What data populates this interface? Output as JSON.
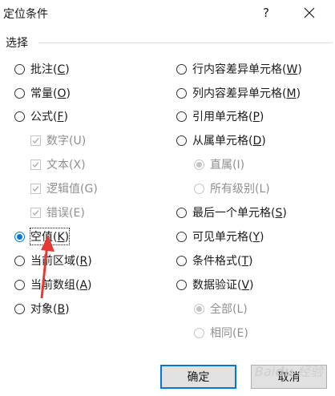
{
  "dialog": {
    "title": "定位条件",
    "help_label": "?",
    "section_label": "选择"
  },
  "left_options": [
    {
      "text": "批注",
      "key": "C",
      "type": "radio",
      "state": "normal"
    },
    {
      "text": "常量",
      "key": "O",
      "type": "radio",
      "state": "normal"
    },
    {
      "text": "公式",
      "key": "F",
      "type": "radio",
      "state": "normal"
    },
    {
      "text": "数字",
      "key": "U",
      "type": "checkbox",
      "state": "disabled-checked"
    },
    {
      "text": "文本",
      "key": "X",
      "type": "checkbox",
      "state": "disabled-checked"
    },
    {
      "text": "逻辑值",
      "key": "G",
      "type": "checkbox",
      "state": "disabled-checked"
    },
    {
      "text": "错误",
      "key": "E",
      "type": "checkbox",
      "state": "disabled-checked"
    },
    {
      "text": "空值",
      "key": "K",
      "type": "radio",
      "state": "selected"
    },
    {
      "text": "当前区域",
      "key": "R",
      "type": "radio",
      "state": "normal"
    },
    {
      "text": "当前数组",
      "key": "A",
      "type": "radio",
      "state": "normal"
    },
    {
      "text": "对象",
      "key": "B",
      "type": "radio",
      "state": "normal"
    }
  ],
  "right_options": [
    {
      "text": "行内容差异单元格",
      "key": "W",
      "type": "radio",
      "state": "normal"
    },
    {
      "text": "列内容差异单元格",
      "key": "M",
      "type": "radio",
      "state": "normal"
    },
    {
      "text": "引用单元格",
      "key": "P",
      "type": "radio",
      "state": "normal"
    },
    {
      "text": "从属单元格",
      "key": "D",
      "type": "radio",
      "state": "normal"
    },
    {
      "text": "直属",
      "key": "I",
      "type": "radio",
      "state": "disabled-selected"
    },
    {
      "text": "所有级别",
      "key": "L",
      "type": "radio",
      "state": "disabled"
    },
    {
      "text": "最后一个单元格",
      "key": "S",
      "type": "radio",
      "state": "normal"
    },
    {
      "text": "可见单元格",
      "key": "Y",
      "type": "radio",
      "state": "normal"
    },
    {
      "text": "条件格式",
      "key": "T",
      "type": "radio",
      "state": "normal"
    },
    {
      "text": "数据验证",
      "key": "V",
      "type": "radio",
      "state": "normal"
    },
    {
      "text": "全部",
      "key": "L",
      "type": "radio",
      "state": "disabled-selected"
    },
    {
      "text": "相同",
      "key": "E",
      "type": "radio",
      "state": "disabled"
    }
  ],
  "buttons": {
    "ok": "确定",
    "cancel": "取消"
  },
  "colors": {
    "accent": "#0078d7",
    "disabled_text": "#8f8f8f",
    "annotation_arrow": "#e53935"
  },
  "annotation": {
    "arrow_icon": "red-arrow-icon"
  },
  "watermark": "Baidu 经验"
}
